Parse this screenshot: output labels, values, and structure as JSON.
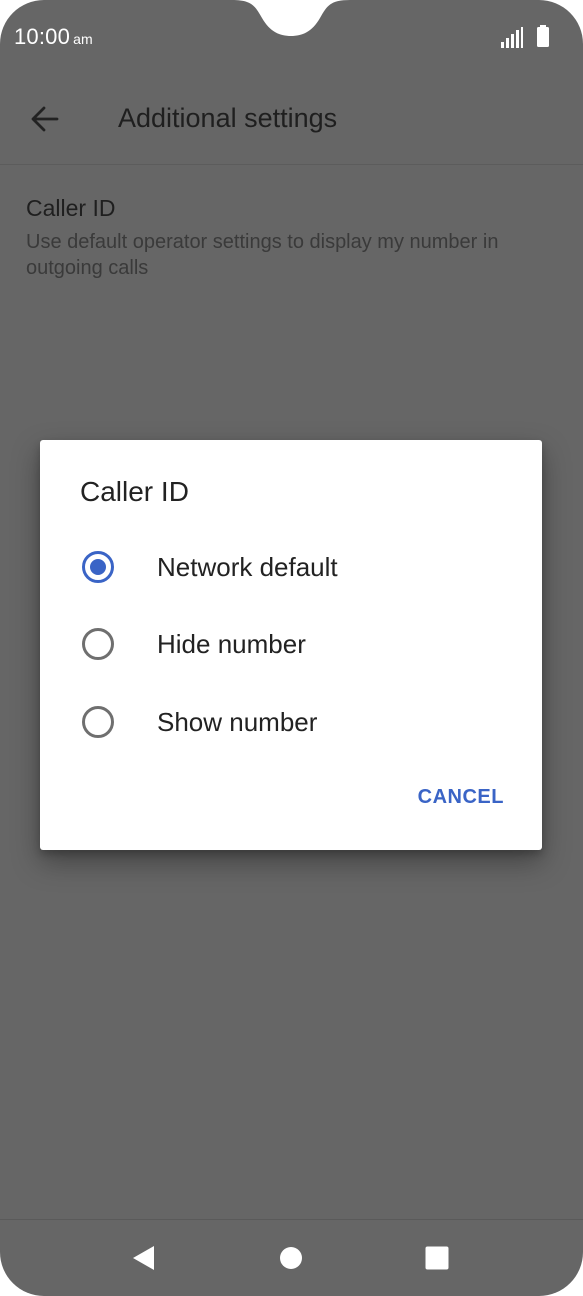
{
  "status_bar": {
    "time": "10:00",
    "ampm": "am",
    "icons": [
      "signal-icon",
      "battery-icon"
    ]
  },
  "app_bar": {
    "back_icon": "arrow-left-icon",
    "title": "Additional settings"
  },
  "setting": {
    "title": "Caller ID",
    "summary": "Use default operator settings to display my number in outgoing calls"
  },
  "dialog": {
    "title": "Caller ID",
    "options": [
      {
        "label": "Network default",
        "selected": true
      },
      {
        "label": "Hide number",
        "selected": false
      },
      {
        "label": "Show number",
        "selected": false
      }
    ],
    "cancel_label": "CANCEL"
  },
  "nav_bar": {
    "icons": [
      "back-triangle-icon",
      "home-circle-icon",
      "recents-square-icon"
    ]
  },
  "colors": {
    "scrim_background": "#666666",
    "dialog_background": "#ffffff",
    "accent": "#3a64c6",
    "radio_unselected": "#6f6f6f"
  }
}
